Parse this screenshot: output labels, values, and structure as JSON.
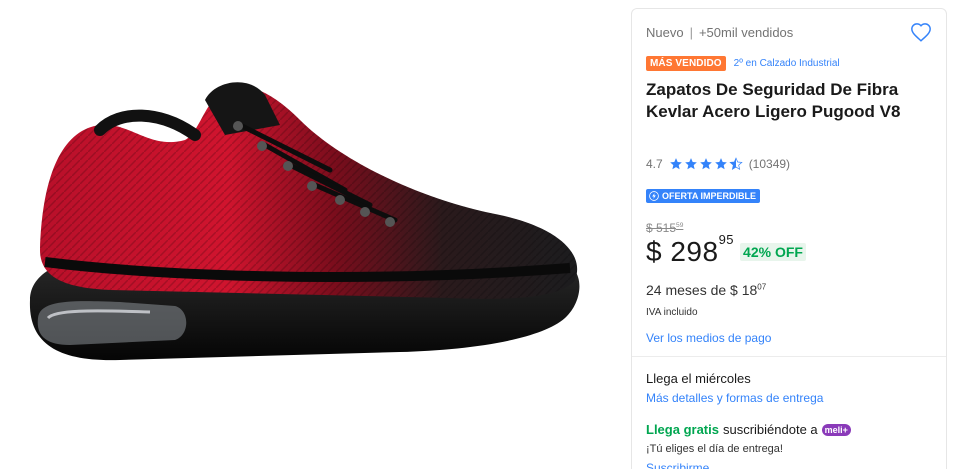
{
  "product": {
    "condition": "Nuevo",
    "sold": "+50mil vendidos",
    "best_seller_badge": "MÁS VENDIDO",
    "rank": "2º en Calzado Industrial",
    "title": "Zapatos De Seguridad De Fibra Kevlar Acero Ligero Pugood V8",
    "rating_value": "4.7",
    "rating_stars": 4.5,
    "review_count": "(10349)",
    "deal_badge": "OFERTA IMPERDIBLE",
    "old_price_int": "$ 515",
    "old_price_cents": "59",
    "price_int": "$ 298",
    "price_cents": "95",
    "discount": "42% OFF",
    "installments_prefix": "24 meses de $ 18",
    "installments_cents": "07",
    "tax_note": "IVA incluido",
    "payment_link": "Ver los medios de pago"
  },
  "shipping": {
    "arrival": "Llega el miércoles",
    "details_link": "Más detalles y formas de entrega",
    "free_label": "Llega gratis",
    "free_suffix": "suscribiéndote a",
    "meli_badge": "meli+",
    "choose_day": "¡Tú eliges el día de entrega!",
    "subscribe_link": "Suscribirme"
  },
  "icons": {
    "favorite": "heart-icon",
    "star": "star-icon",
    "deal": "lightning-icon"
  },
  "colors": {
    "accent_blue": "#3483fa",
    "best_seller_orange": "#ff7733",
    "green": "#00a650",
    "meli_purple": "#8a3ab9",
    "shoe_red": "#c4122a"
  }
}
